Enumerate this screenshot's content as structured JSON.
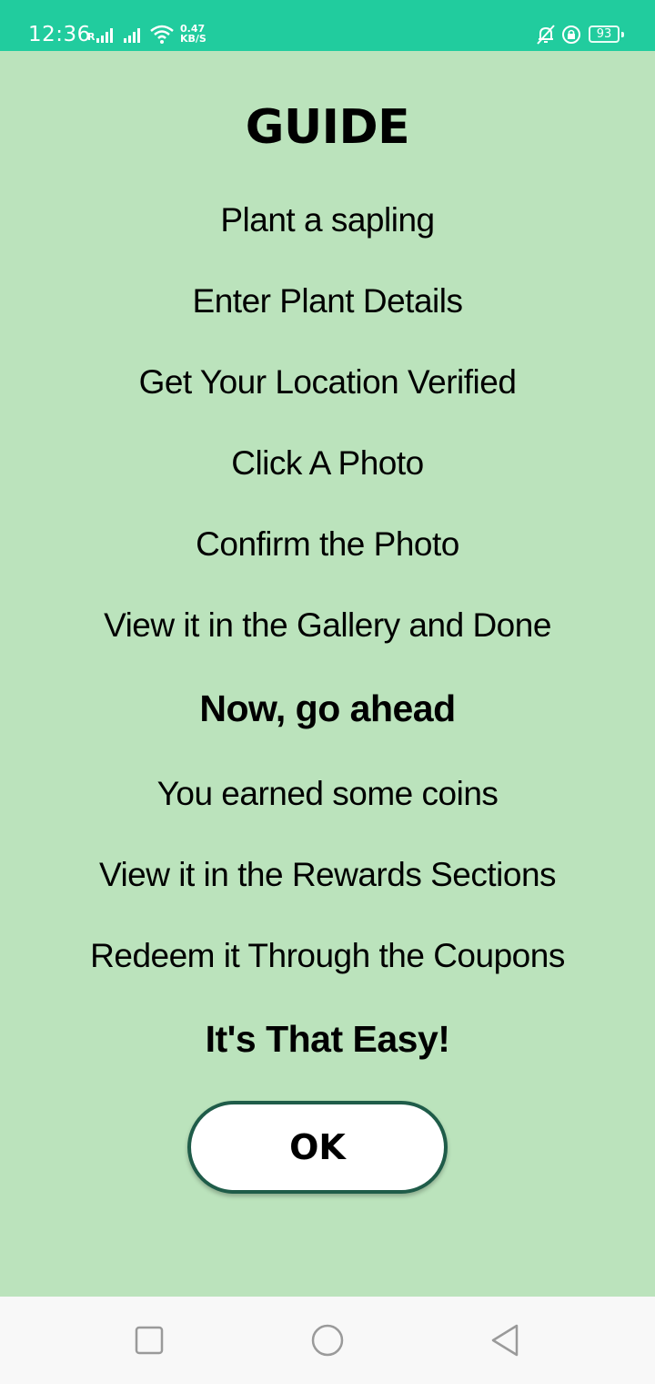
{
  "status_bar": {
    "time": "12:36",
    "roaming": "R",
    "speed_value": "0.47",
    "speed_unit": "KB/S",
    "battery": "93",
    "icons": [
      "signal-icon",
      "signal-icon",
      "wifi-icon",
      "bell-off-icon",
      "lock-rotation-icon",
      "battery-icon"
    ],
    "background": "#21cc9e"
  },
  "guide": {
    "title": "GUIDE",
    "steps": [
      "Plant a sapling",
      "Enter Plant Details",
      "Get Your Location Verified",
      "Click A Photo",
      "Confirm the Photo",
      "View it in the Gallery and Done"
    ],
    "heading_2": "Now, go ahead",
    "rewards": [
      "You earned some coins",
      "View it in the Rewards Sections",
      "Redeem it Through the Coupons"
    ],
    "closing": "It's That Easy!",
    "ok_label": "OK"
  },
  "nav_bar": {
    "buttons": [
      "recents-icon",
      "home-icon",
      "back-icon"
    ]
  },
  "colors": {
    "background": "#bbe3bc",
    "button_border": "#1f5c49",
    "status_bar": "#21cc9e"
  }
}
